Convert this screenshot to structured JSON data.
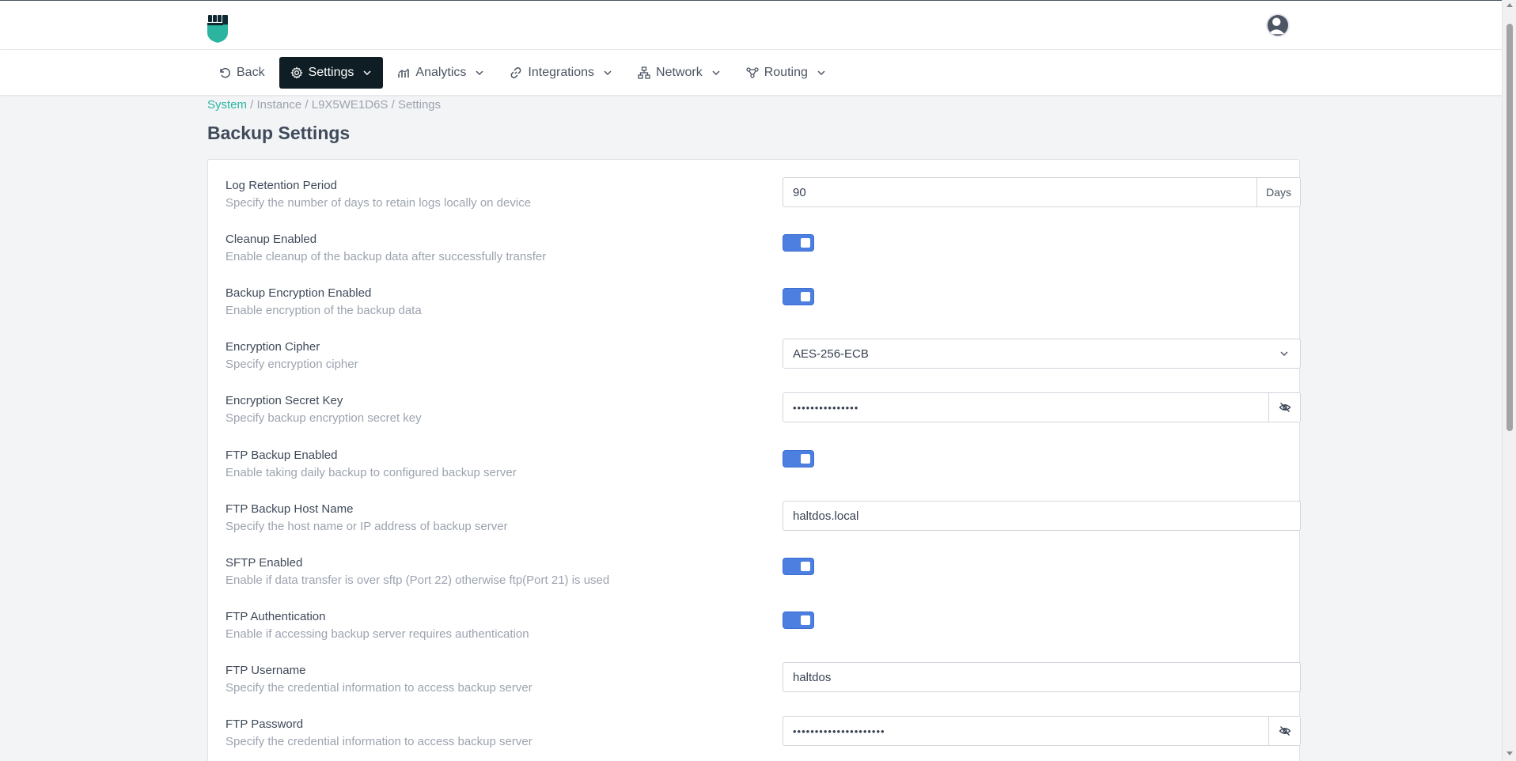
{
  "header": {
    "logo_icon": "fist-shield-logo",
    "avatar_icon": "user-avatar",
    "brand_color": "#2bb5a0"
  },
  "nav": {
    "back_label": "Back",
    "items": [
      {
        "label": "Settings",
        "icon": "gear-icon",
        "active": true
      },
      {
        "label": "Analytics",
        "icon": "chart-icon",
        "active": false
      },
      {
        "label": "Integrations",
        "icon": "link-icon",
        "active": false
      },
      {
        "label": "Network",
        "icon": "network-icon",
        "active": false
      },
      {
        "label": "Routing",
        "icon": "routing-icon",
        "active": false
      }
    ]
  },
  "breadcrumb": {
    "root": "System",
    "rest": " / Instance / L9X5WE1D6S / Settings"
  },
  "page": {
    "title": "Backup Settings"
  },
  "settings": [
    {
      "label": "Log Retention Period",
      "description": "Specify the number of days to retain logs locally on device",
      "type": "input-addon",
      "value": "90",
      "addon": "Days"
    },
    {
      "label": "Cleanup Enabled",
      "description": "Enable cleanup of the backup data after successfully transfer",
      "type": "toggle",
      "value": true
    },
    {
      "label": "Backup Encryption Enabled",
      "description": "Enable encryption of the backup data",
      "type": "toggle",
      "value": true
    },
    {
      "label": "Encryption Cipher",
      "description": "Specify encryption cipher",
      "type": "select",
      "value": "AES-256-ECB"
    },
    {
      "label": "Encryption Secret Key",
      "description": "Specify backup encryption secret key",
      "type": "password",
      "value": "•••••••••••••••"
    },
    {
      "label": "FTP Backup Enabled",
      "description": "Enable taking daily backup to configured backup server",
      "type": "toggle",
      "value": true
    },
    {
      "label": "FTP Backup Host Name",
      "description": "Specify the host name or IP address of backup server",
      "type": "input",
      "value": "haltdos.local"
    },
    {
      "label": "SFTP Enabled",
      "description": "Enable if data transfer is over sftp (Port 22) otherwise ftp(Port 21) is used",
      "type": "toggle",
      "value": true
    },
    {
      "label": "FTP Authentication",
      "description": "Enable if accessing backup server requires authentication",
      "type": "toggle",
      "value": true
    },
    {
      "label": "FTP Username",
      "description": "Specify the credential information to access backup server",
      "type": "input",
      "value": "haltdos"
    },
    {
      "label": "FTP Password",
      "description": "Specify the credential information to access backup server",
      "type": "password",
      "value": "•••••••••••••••••••••"
    }
  ],
  "colors": {
    "toggle_on": "#4c7fe0",
    "nav_active_bg": "#0f1e24"
  }
}
